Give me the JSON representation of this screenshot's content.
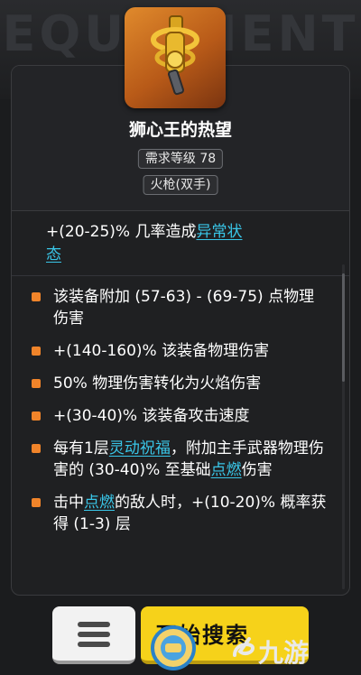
{
  "background": {
    "title": "EQUIPMENT"
  },
  "item": {
    "name": "狮心王的热望",
    "level_requirement": "需求等级 78",
    "weapon_type": "火枪(双手)",
    "icon": "golden-firearm-icon"
  },
  "implicit": {
    "prefix": "+(20-25)% 几率造成",
    "keyword": "异常状",
    "keyword_tail": "态"
  },
  "modifiers": [
    {
      "text": "该装备附加 (57-63) - (69-75) 点物理伤害"
    },
    {
      "text": "+(140-160)% 该装备物理伤害"
    },
    {
      "text": "50% 物理伤害转化为火焰伤害"
    },
    {
      "text": "+(30-40)% 该装备攻击速度"
    },
    {
      "pre": "每有1层",
      "kw1": "灵动祝福",
      "mid": "，附加主手武器物理伤害的 (30-40)% 至基础",
      "kw2": "点燃",
      "post": "伤害"
    },
    {
      "pre": "击中",
      "kw1": "点燃",
      "post": "的敌人时，+(10-20)% 概率获得 (1-3) 层"
    }
  ],
  "bottom_bar": {
    "menu_icon": "hamburger-icon",
    "start_label": "开始搜索"
  },
  "watermark": {
    "text": "九游",
    "logo": "seal-logo"
  },
  "colors": {
    "accent": "#f0842a",
    "keyword": "#39c6e8",
    "button_yellow": "#f6d21a"
  }
}
